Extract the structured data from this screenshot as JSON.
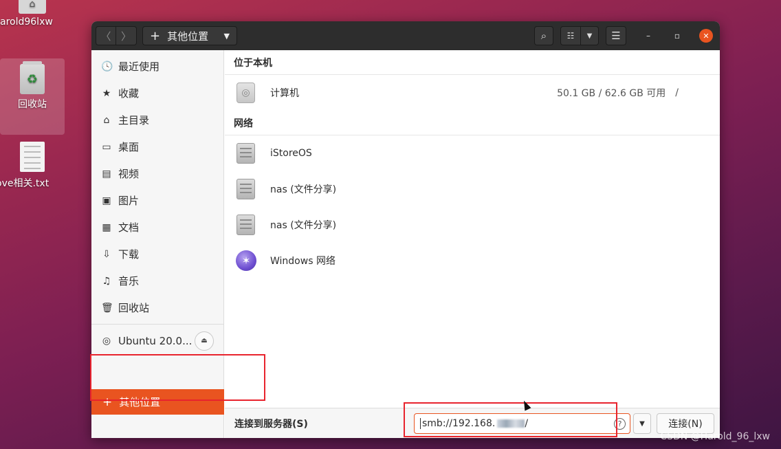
{
  "desktop": {
    "home_label": "arold96lxw",
    "trash_label": "回收站",
    "file_label": "ove相关.txt",
    "trash_symbol": "♻"
  },
  "headerbar": {
    "back": "〈",
    "forward": "〉",
    "path_plus": "+",
    "path_label": "其他位置",
    "path_caret": "▼",
    "search_icon": "⌕",
    "view_icon": "☷",
    "view_caret": "▼",
    "menu_icon": "☰",
    "minimize": "–",
    "maximize": "▫",
    "close": "✕"
  },
  "sidebar": {
    "items": [
      {
        "icon": "🕓",
        "label": "最近使用"
      },
      {
        "icon": "★",
        "label": "收藏"
      },
      {
        "icon": "⌂",
        "label": "主目录"
      },
      {
        "icon": "▭",
        "label": "桌面"
      },
      {
        "icon": "▤",
        "label": "视频"
      },
      {
        "icon": "▣",
        "label": "图片"
      },
      {
        "icon": "▦",
        "label": "文档"
      },
      {
        "icon": "⇩",
        "label": "下载"
      },
      {
        "icon": "♫",
        "label": "音乐"
      },
      {
        "icon": "🗑",
        "label": "回收站"
      }
    ],
    "drive": {
      "icon": "◎",
      "label": "Ubuntu 20.0...",
      "eject": "⏏"
    },
    "other": {
      "icon": "+",
      "label": "其他位置"
    }
  },
  "main": {
    "local_header": "位于本机",
    "computer": {
      "label": "计算机",
      "space": "50.1 GB / 62.6 GB 可用",
      "mount": "/"
    },
    "network_header": "网络",
    "network_items": [
      {
        "label": "iStoreOS"
      },
      {
        "label": "nas (文件分享)"
      },
      {
        "label": "nas (文件分享)"
      },
      {
        "label": "Windows 网络"
      }
    ]
  },
  "bottom": {
    "label": "连接到服务器(S)",
    "server_value": "smb://192.168.",
    "server_value_tail": "/",
    "help": "?",
    "dropdown": "▼",
    "connect": "连接(N)"
  },
  "watermark": "CSDN @Harold_96_lxw"
}
